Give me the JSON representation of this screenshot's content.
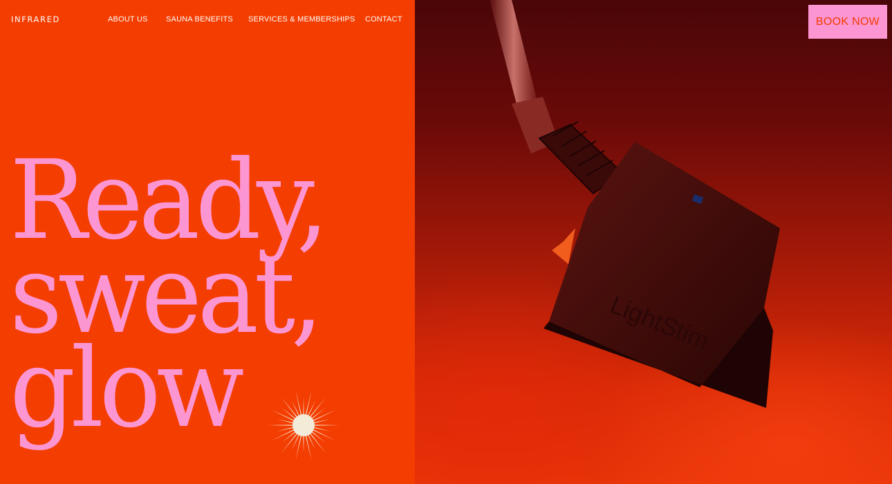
{
  "brand": {
    "logo_text": "INFRARED"
  },
  "nav": {
    "items": [
      {
        "label": "ABOUT US"
      },
      {
        "label": "SAUNA BENEFITS"
      },
      {
        "label": "SERVICES & MEMBERSHIPS"
      },
      {
        "label": "CONTACT"
      }
    ]
  },
  "cta": {
    "book_label": "BOOK NOW"
  },
  "hero": {
    "line1": "Ready,",
    "line2": "sweat,",
    "line3": "glow",
    "device_text": "LightStim"
  },
  "colors": {
    "accent_orange": "#f43d00",
    "pink": "#fc96d2",
    "burst": "#f4ead8"
  },
  "icons": {
    "burst": "sunburst-icon"
  }
}
